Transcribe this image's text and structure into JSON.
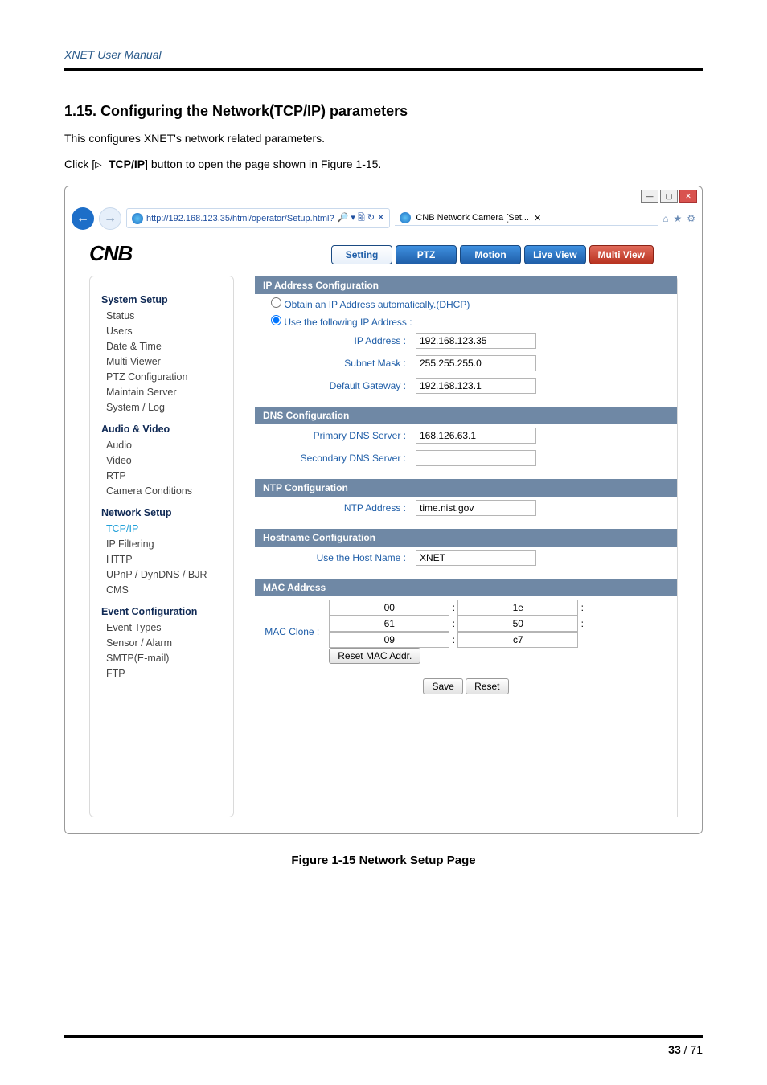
{
  "doc": {
    "header": "XNET User Manual",
    "section_no": "1.15.",
    "section_title": "Configuring the Network(TCP/IP) parameters",
    "intro": "This configures XNET's network related parameters.",
    "click_pre": "Click [",
    "click_tri": "▷ ",
    "click_bold": "TCP/IP",
    "click_post": "] button to open the page shown in Figure 1-15.",
    "figure_caption": "Figure 1-15 Network Setup Page",
    "page_bold": "33",
    "page_sep": " / ",
    "page_total": "71"
  },
  "browser": {
    "url": "http://192.168.123.35/html/operator/Setup.html?",
    "url_tools": "🔎 ▾  🗟 ↻ ✕",
    "tab_title": "CNB Network Camera [Set...",
    "tab_x": "✕",
    "home_icon": "⌂",
    "star_icon": "★",
    "gear_icon": "⚙"
  },
  "app": {
    "logo": "CNB",
    "nav": {
      "setting": "Setting",
      "ptz": "PTZ",
      "motion": "Motion",
      "liveview": "Live View",
      "multiview": "Multi View"
    },
    "side": {
      "g1": "System Setup",
      "g1_items": [
        "Status",
        "Users",
        "Date & Time",
        "Multi Viewer",
        "PTZ Configuration",
        "Maintain Server",
        "System / Log"
      ],
      "g2": "Audio & Video",
      "g2_items": [
        "Audio",
        "Video",
        "RTP",
        "Camera Conditions"
      ],
      "g3": "Network Setup",
      "g3_items": [
        "TCP/IP",
        "IP Filtering",
        "HTTP",
        "UPnP / DynDNS / BJR",
        "CMS"
      ],
      "g4": "Event Configuration",
      "g4_items": [
        "Event Types",
        "Sensor / Alarm",
        "SMTP(E-mail)",
        "FTP"
      ]
    },
    "cfg": {
      "ip_head": "IP Address Configuration",
      "ip_dhcp": "Obtain an IP Address automatically.(DHCP)",
      "ip_static": "Use the following IP Address :",
      "ip_label": "IP Address :",
      "ip_value": "192.168.123.35",
      "mask_label": "Subnet Mask :",
      "mask_value": "255.255.255.0",
      "gw_label": "Default Gateway :",
      "gw_value": "192.168.123.1",
      "dns_head": "DNS Configuration",
      "dns1_label": "Primary DNS Server :",
      "dns1_value": "168.126.63.1",
      "dns2_label": "Secondary DNS Server :",
      "dns2_value": "",
      "ntp_head": "NTP Configuration",
      "ntp_label": "NTP Address :",
      "ntp_value": "time.nist.gov",
      "host_head": "Hostname Configuration",
      "host_label": "Use the Host Name :",
      "host_value": "XNET",
      "mac_head": "MAC Address",
      "mac_label": "MAC Clone :",
      "mac": [
        "00",
        "1e",
        "61",
        "50",
        "09",
        "c7"
      ],
      "reset_mac_btn": "Reset MAC Addr.",
      "save_btn": "Save",
      "reset_btn": "Reset"
    }
  }
}
